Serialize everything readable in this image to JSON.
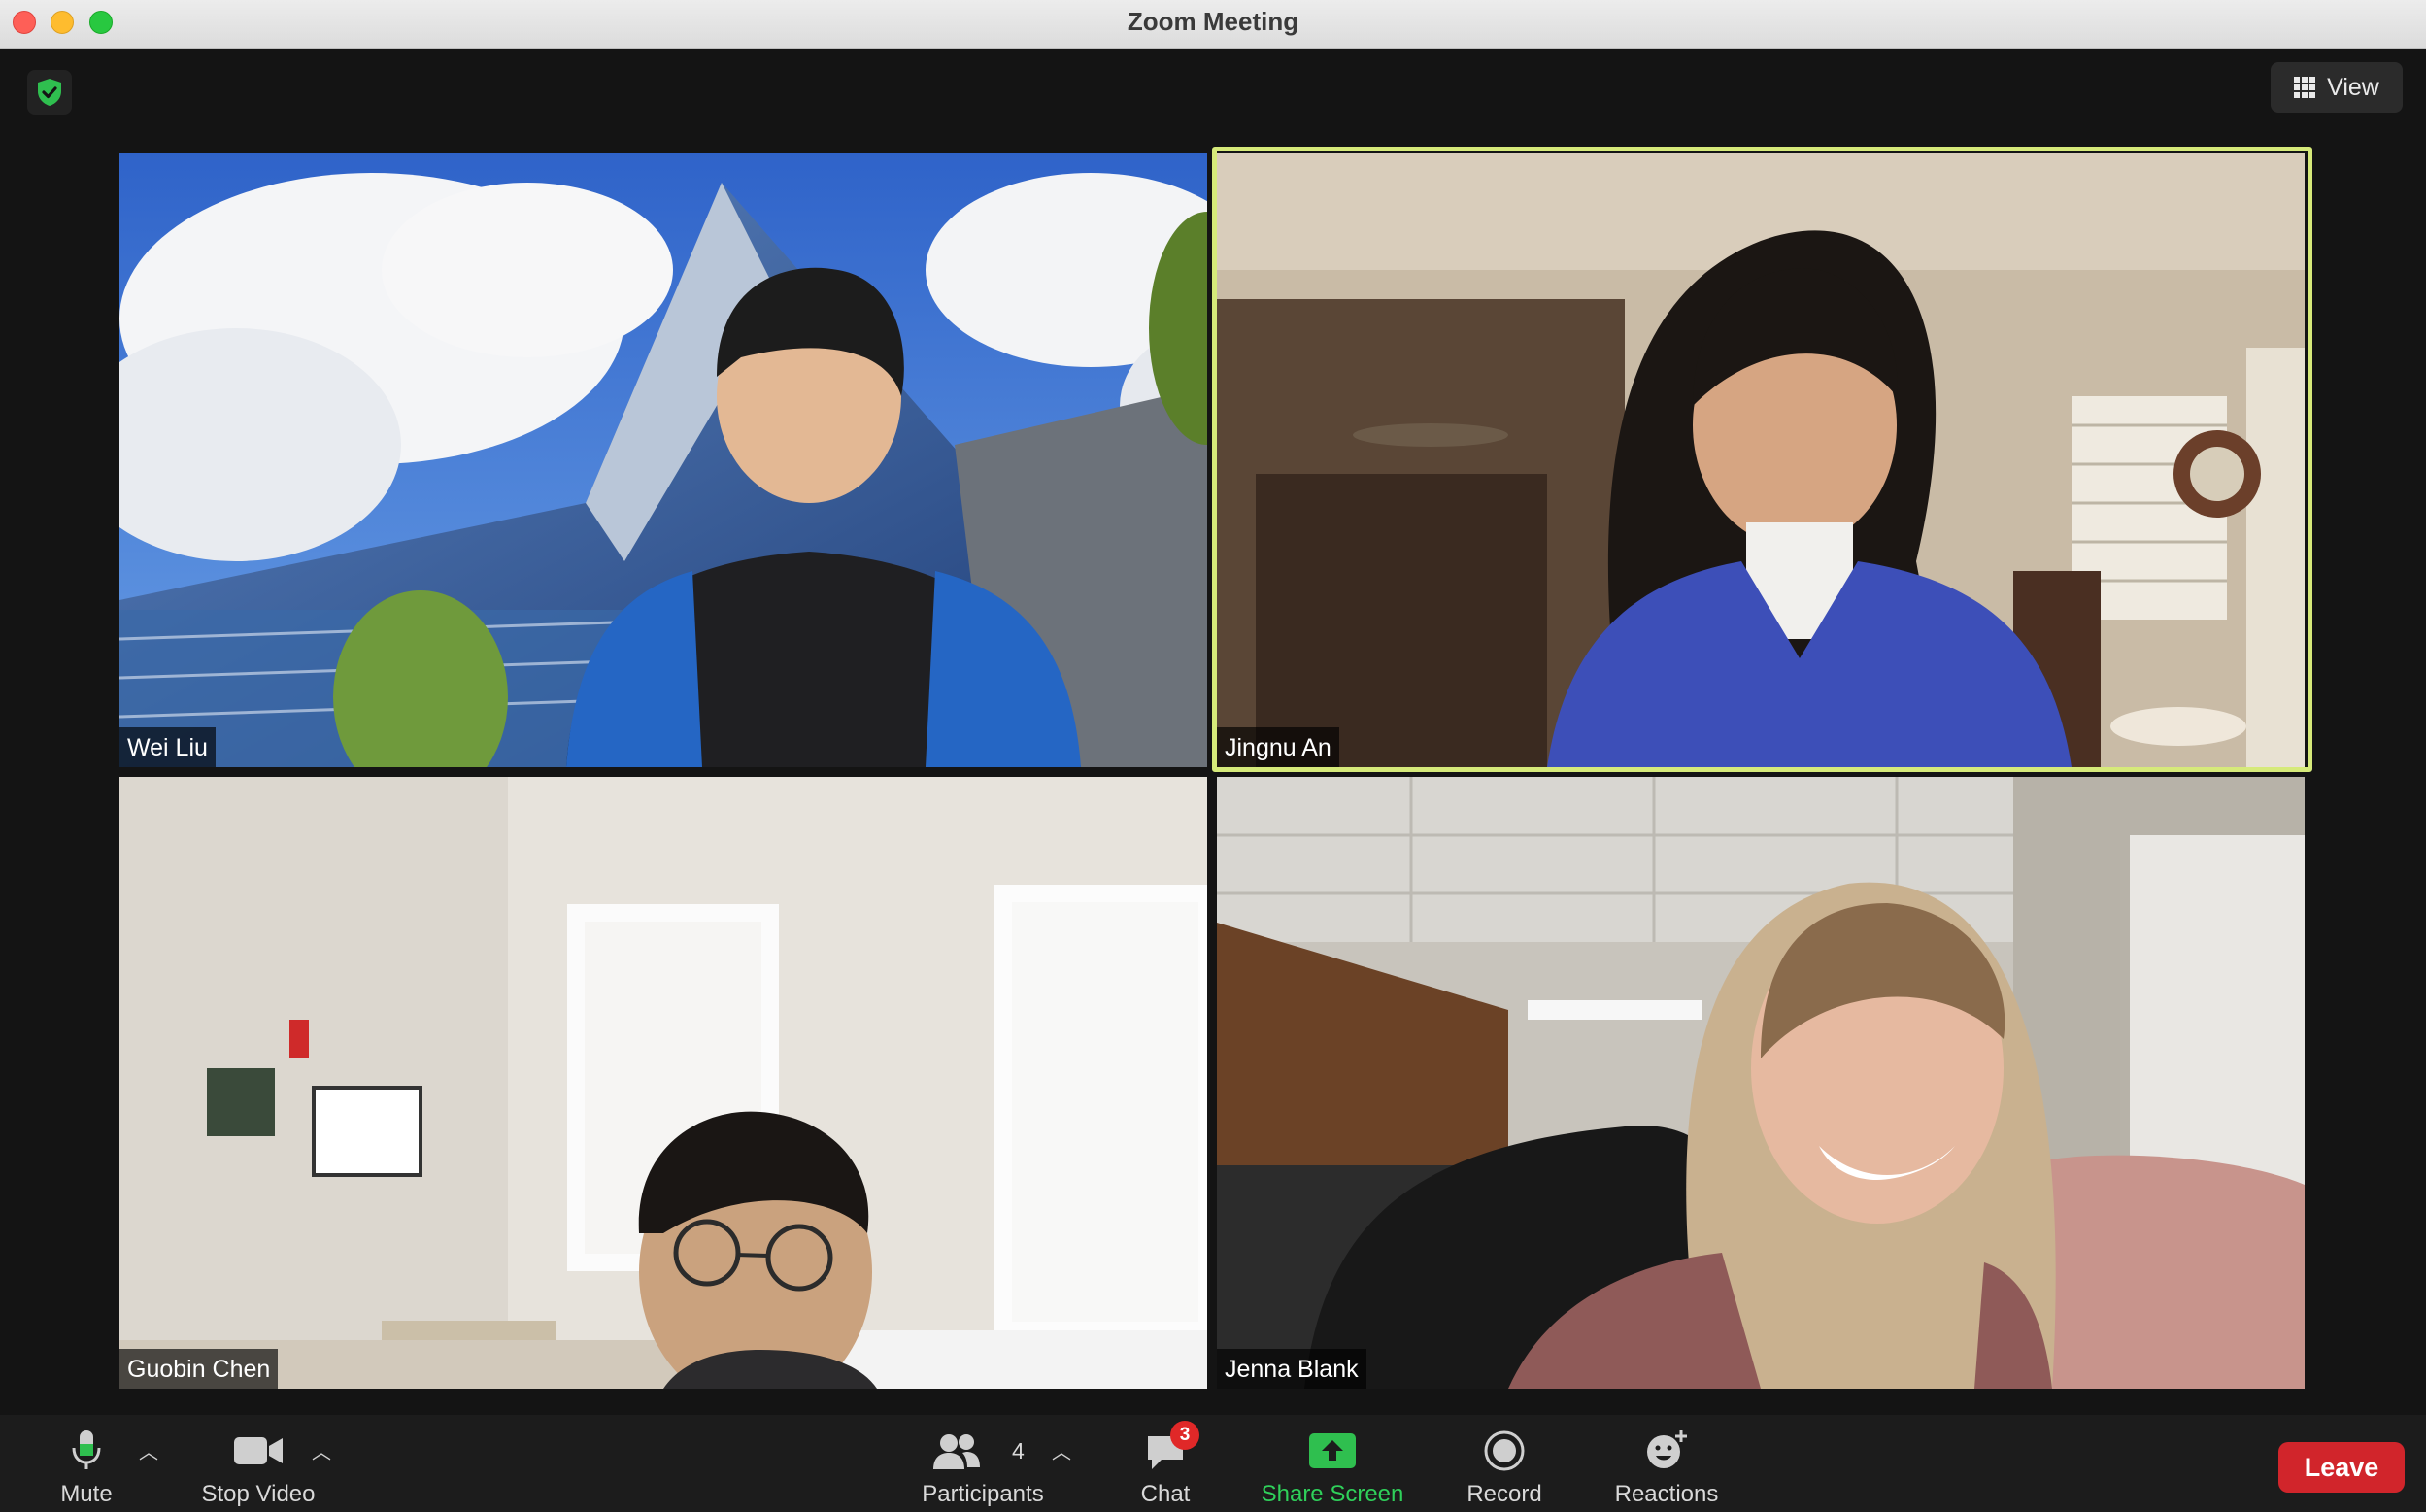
{
  "window": {
    "title": "Zoom Meeting"
  },
  "header": {
    "view_label": "View"
  },
  "participants": [
    {
      "name": "Wei Liu"
    },
    {
      "name": "Jingnu An"
    },
    {
      "name": "Guobin Chen"
    },
    {
      "name": "Jenna Blank"
    }
  ],
  "toolbar": {
    "mute_label": "Mute",
    "stop_video_label": "Stop Video",
    "participants_label": "Participants",
    "participants_count": "4",
    "chat_label": "Chat",
    "chat_badge": "3",
    "share_screen_label": "Share Screen",
    "record_label": "Record",
    "reactions_label": "Reactions",
    "leave_label": "Leave"
  },
  "colors": {
    "active_speaker": "#d6ea7a",
    "share_screen": "#2fbf4f",
    "leave": "#d1252b",
    "shield": "#2fbf4f"
  },
  "icons": [
    "shield-check-icon",
    "grid-icon",
    "microphone-icon",
    "video-camera-icon",
    "participants-icon",
    "chat-icon",
    "share-screen-icon",
    "record-icon",
    "reactions-icon",
    "caret-up-icon"
  ]
}
